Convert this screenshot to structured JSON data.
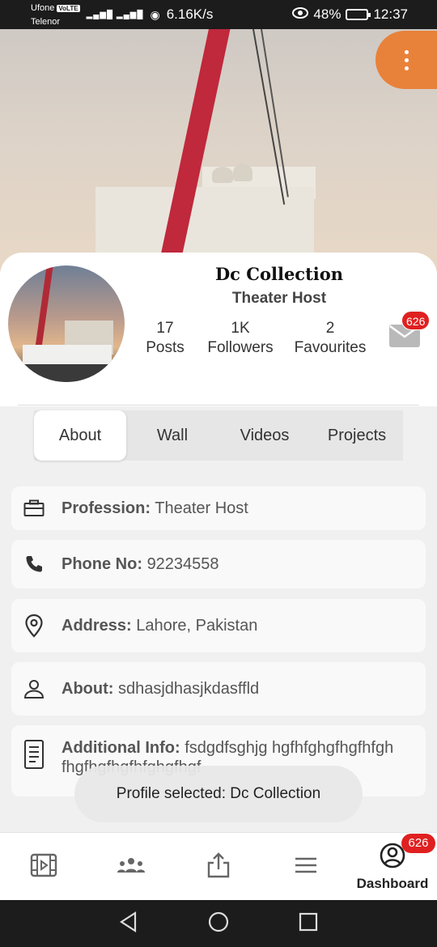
{
  "status_bar": {
    "carrier1": "Ufone",
    "carrier1_tag": "VoLTE",
    "carrier2": "Telenor",
    "speed": "6.16K/s",
    "battery": "48%",
    "time": "12:37"
  },
  "profile": {
    "name": "Dc Collection",
    "role": "Theater Host",
    "stats": [
      {
        "value": "17",
        "label": "Posts"
      },
      {
        "value": "1K",
        "label": "Followers"
      },
      {
        "value": "2",
        "label": "Favourites"
      }
    ],
    "mail_badge": "626"
  },
  "tabs": [
    {
      "label": "About",
      "active": true
    },
    {
      "label": "Wall",
      "active": false
    },
    {
      "label": "Videos",
      "active": false
    },
    {
      "label": "Projects",
      "active": false
    }
  ],
  "info": {
    "profession_label": "Profession:",
    "profession_value": "Theater Host",
    "phone_label": "Phone No:",
    "phone_value": "92234558",
    "address_label": "Address:",
    "address_value": "Lahore, Pakistan",
    "about_label": "About:",
    "about_value": "sdhasjdhasjkdasffld",
    "additional_label": "Additional Info:",
    "additional_value": "fsdgdfsghjg hgfhfghgfhgfhfgh fhgfhgfhgfhfghgfhgf"
  },
  "toast": "Profile selected: Dc Collection",
  "bottom_nav": {
    "dashboard_label": "Dashboard",
    "dashboard_badge": "626"
  },
  "colors": {
    "accent_orange": "#e8823b",
    "badge_red": "#e02020"
  }
}
